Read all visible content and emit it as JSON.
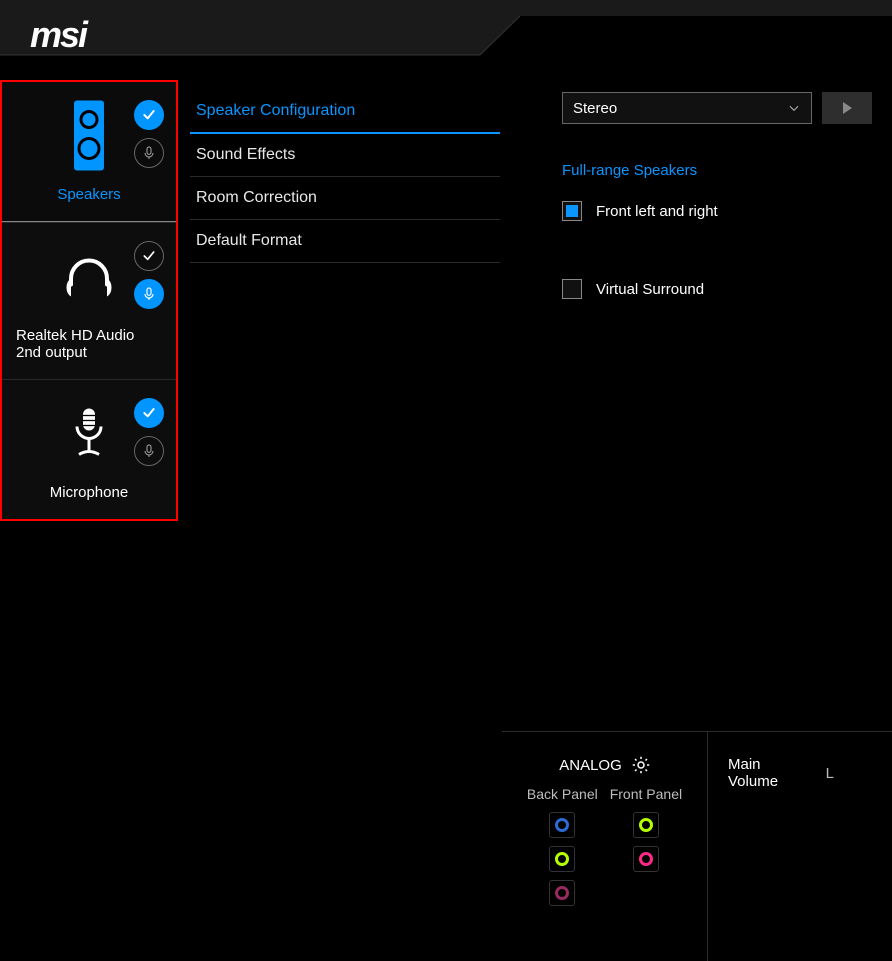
{
  "logo_text": "msi",
  "sidebar": {
    "devices": [
      {
        "label": "Speakers",
        "check_active": true,
        "mic_active": false,
        "selected": true
      },
      {
        "label": "Realtek HD Audio 2nd output",
        "check_active": false,
        "mic_active": true,
        "selected": false
      },
      {
        "label": "Microphone",
        "check_active": true,
        "mic_active": false,
        "selected": false
      }
    ]
  },
  "nav": {
    "items": [
      {
        "label": "Speaker Configuration",
        "active": true
      },
      {
        "label": "Sound Effects",
        "active": false
      },
      {
        "label": "Room Correction",
        "active": false
      },
      {
        "label": "Default Format",
        "active": false
      }
    ]
  },
  "config": {
    "select_value": "Stereo",
    "section_label": "Full-range Speakers",
    "front_lr": {
      "label": "Front left and right",
      "checked": true
    },
    "virtual": {
      "label": "Virtual Surround",
      "checked": false
    }
  },
  "analog": {
    "title": "ANALOG",
    "back_label": "Back Panel",
    "front_label": "Front Panel"
  },
  "volume": {
    "title": "Main Volume",
    "channel": "L"
  }
}
